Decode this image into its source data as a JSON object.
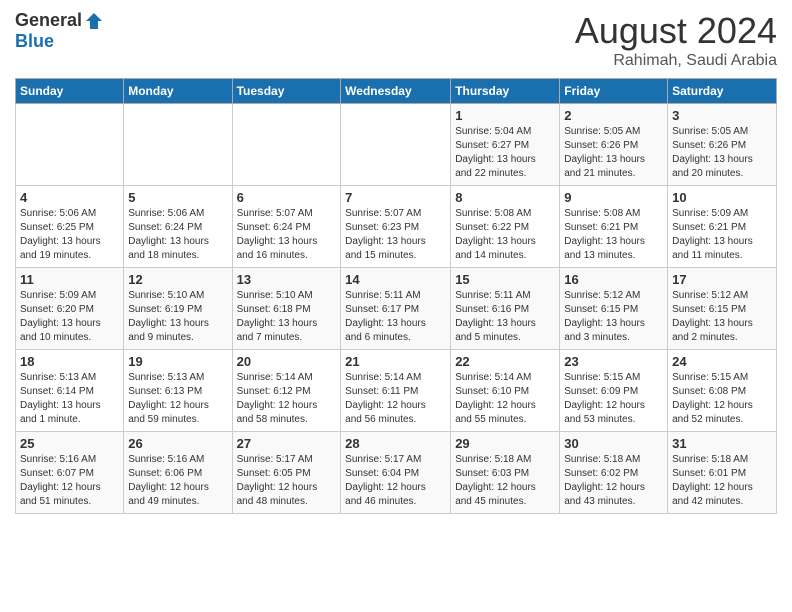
{
  "header": {
    "logo_general": "General",
    "logo_blue": "Blue",
    "month_title": "August 2024",
    "location": "Rahimah, Saudi Arabia"
  },
  "days_of_week": [
    "Sunday",
    "Monday",
    "Tuesday",
    "Wednesday",
    "Thursday",
    "Friday",
    "Saturday"
  ],
  "weeks": [
    [
      {
        "day": "",
        "info": ""
      },
      {
        "day": "",
        "info": ""
      },
      {
        "day": "",
        "info": ""
      },
      {
        "day": "",
        "info": ""
      },
      {
        "day": "1",
        "info": "Sunrise: 5:04 AM\nSunset: 6:27 PM\nDaylight: 13 hours\nand 22 minutes."
      },
      {
        "day": "2",
        "info": "Sunrise: 5:05 AM\nSunset: 6:26 PM\nDaylight: 13 hours\nand 21 minutes."
      },
      {
        "day": "3",
        "info": "Sunrise: 5:05 AM\nSunset: 6:26 PM\nDaylight: 13 hours\nand 20 minutes."
      }
    ],
    [
      {
        "day": "4",
        "info": "Sunrise: 5:06 AM\nSunset: 6:25 PM\nDaylight: 13 hours\nand 19 minutes."
      },
      {
        "day": "5",
        "info": "Sunrise: 5:06 AM\nSunset: 6:24 PM\nDaylight: 13 hours\nand 18 minutes."
      },
      {
        "day": "6",
        "info": "Sunrise: 5:07 AM\nSunset: 6:24 PM\nDaylight: 13 hours\nand 16 minutes."
      },
      {
        "day": "7",
        "info": "Sunrise: 5:07 AM\nSunset: 6:23 PM\nDaylight: 13 hours\nand 15 minutes."
      },
      {
        "day": "8",
        "info": "Sunrise: 5:08 AM\nSunset: 6:22 PM\nDaylight: 13 hours\nand 14 minutes."
      },
      {
        "day": "9",
        "info": "Sunrise: 5:08 AM\nSunset: 6:21 PM\nDaylight: 13 hours\nand 13 minutes."
      },
      {
        "day": "10",
        "info": "Sunrise: 5:09 AM\nSunset: 6:21 PM\nDaylight: 13 hours\nand 11 minutes."
      }
    ],
    [
      {
        "day": "11",
        "info": "Sunrise: 5:09 AM\nSunset: 6:20 PM\nDaylight: 13 hours\nand 10 minutes."
      },
      {
        "day": "12",
        "info": "Sunrise: 5:10 AM\nSunset: 6:19 PM\nDaylight: 13 hours\nand 9 minutes."
      },
      {
        "day": "13",
        "info": "Sunrise: 5:10 AM\nSunset: 6:18 PM\nDaylight: 13 hours\nand 7 minutes."
      },
      {
        "day": "14",
        "info": "Sunrise: 5:11 AM\nSunset: 6:17 PM\nDaylight: 13 hours\nand 6 minutes."
      },
      {
        "day": "15",
        "info": "Sunrise: 5:11 AM\nSunset: 6:16 PM\nDaylight: 13 hours\nand 5 minutes."
      },
      {
        "day": "16",
        "info": "Sunrise: 5:12 AM\nSunset: 6:15 PM\nDaylight: 13 hours\nand 3 minutes."
      },
      {
        "day": "17",
        "info": "Sunrise: 5:12 AM\nSunset: 6:15 PM\nDaylight: 13 hours\nand 2 minutes."
      }
    ],
    [
      {
        "day": "18",
        "info": "Sunrise: 5:13 AM\nSunset: 6:14 PM\nDaylight: 13 hours\nand 1 minute."
      },
      {
        "day": "19",
        "info": "Sunrise: 5:13 AM\nSunset: 6:13 PM\nDaylight: 12 hours\nand 59 minutes."
      },
      {
        "day": "20",
        "info": "Sunrise: 5:14 AM\nSunset: 6:12 PM\nDaylight: 12 hours\nand 58 minutes."
      },
      {
        "day": "21",
        "info": "Sunrise: 5:14 AM\nSunset: 6:11 PM\nDaylight: 12 hours\nand 56 minutes."
      },
      {
        "day": "22",
        "info": "Sunrise: 5:14 AM\nSunset: 6:10 PM\nDaylight: 12 hours\nand 55 minutes."
      },
      {
        "day": "23",
        "info": "Sunrise: 5:15 AM\nSunset: 6:09 PM\nDaylight: 12 hours\nand 53 minutes."
      },
      {
        "day": "24",
        "info": "Sunrise: 5:15 AM\nSunset: 6:08 PM\nDaylight: 12 hours\nand 52 minutes."
      }
    ],
    [
      {
        "day": "25",
        "info": "Sunrise: 5:16 AM\nSunset: 6:07 PM\nDaylight: 12 hours\nand 51 minutes."
      },
      {
        "day": "26",
        "info": "Sunrise: 5:16 AM\nSunset: 6:06 PM\nDaylight: 12 hours\nand 49 minutes."
      },
      {
        "day": "27",
        "info": "Sunrise: 5:17 AM\nSunset: 6:05 PM\nDaylight: 12 hours\nand 48 minutes."
      },
      {
        "day": "28",
        "info": "Sunrise: 5:17 AM\nSunset: 6:04 PM\nDaylight: 12 hours\nand 46 minutes."
      },
      {
        "day": "29",
        "info": "Sunrise: 5:18 AM\nSunset: 6:03 PM\nDaylight: 12 hours\nand 45 minutes."
      },
      {
        "day": "30",
        "info": "Sunrise: 5:18 AM\nSunset: 6:02 PM\nDaylight: 12 hours\nand 43 minutes."
      },
      {
        "day": "31",
        "info": "Sunrise: 5:18 AM\nSunset: 6:01 PM\nDaylight: 12 hours\nand 42 minutes."
      }
    ]
  ]
}
